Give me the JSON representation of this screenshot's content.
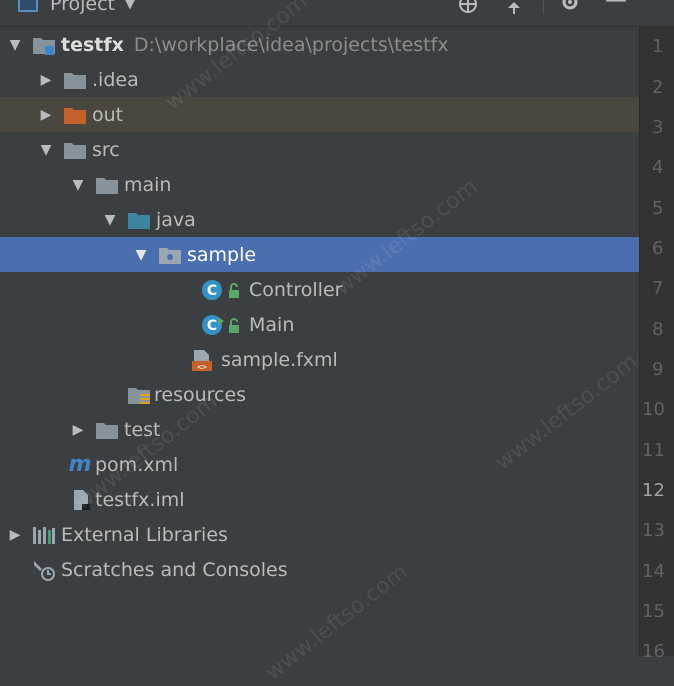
{
  "header": {
    "title": "Project",
    "caret": "▼"
  },
  "tree": {
    "root": {
      "label": "testfx",
      "path": "D:\\workplace\\idea\\projects\\testfx"
    },
    "idea": {
      "label": ".idea"
    },
    "out": {
      "label": "out"
    },
    "src": {
      "label": "src"
    },
    "main": {
      "label": "main"
    },
    "java": {
      "label": "java"
    },
    "sample": {
      "label": "sample"
    },
    "controller": {
      "label": "Controller"
    },
    "main_class": {
      "label": "Main"
    },
    "sample_fxml": {
      "label": "sample.fxml"
    },
    "resources": {
      "label": "resources"
    },
    "test": {
      "label": "test"
    },
    "pom": {
      "label": "pom.xml",
      "icon_glyph": "m"
    },
    "iml": {
      "label": "testfx.iml"
    },
    "external_libraries": {
      "label": "External Libraries"
    },
    "scratches": {
      "label": "Scratches and Consoles"
    }
  },
  "gutter": {
    "line_numbers": [
      "1",
      "2",
      "3",
      "4",
      "5",
      "6",
      "7",
      "8",
      "9",
      "10",
      "11",
      "12",
      "13",
      "14",
      "15",
      "16"
    ]
  },
  "watermark": {
    "text": "www.leftso.com"
  },
  "colors": {
    "background": "#3c3f41",
    "selection": "#4b6eaf",
    "folder": "#87939a",
    "source_folder": "#3e86a0",
    "out_folder": "#c3612d",
    "class_icon": "#3592c4",
    "lock": "#59a869"
  },
  "arrows": {
    "expanded": "▼",
    "collapsed": "▶"
  }
}
